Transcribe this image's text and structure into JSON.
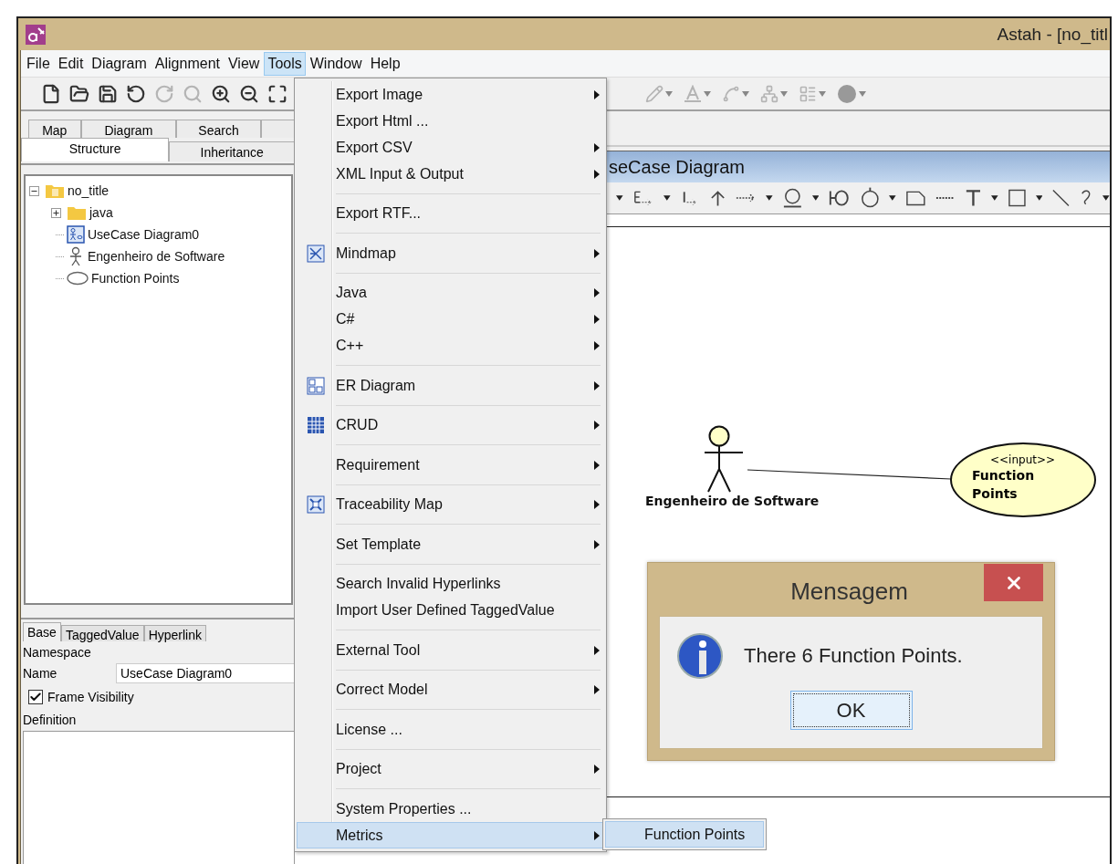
{
  "window": {
    "title": "Astah - [no_titl"
  },
  "menu_bar": [
    {
      "label": "File",
      "selected": false
    },
    {
      "label": "Edit",
      "selected": false
    },
    {
      "label": "Diagram",
      "selected": false
    },
    {
      "label": "Alignment",
      "selected": false
    },
    {
      "label": "View",
      "selected": false
    },
    {
      "label": "Tools",
      "selected": true
    },
    {
      "label": "Window",
      "selected": false
    },
    {
      "label": "Help",
      "selected": false
    }
  ],
  "toolbar": {
    "left": [
      {
        "disabled": false
      },
      {
        "disabled": false
      },
      {
        "disabled": false
      },
      {
        "disabled": false
      },
      {
        "disabled": true
      },
      {
        "disabled": true
      },
      {
        "disabled": false
      },
      {
        "disabled": false
      },
      {
        "disabled": false
      }
    ],
    "right": [
      {
        "disabled": true
      },
      {
        "disabled": true
      },
      {
        "disabled": true
      },
      {
        "disabled": true
      },
      {
        "disabled": true
      },
      {
        "disabled": true
      }
    ]
  },
  "explorer": {
    "tabs_upper": [
      {
        "label": "Map",
        "selected": false
      },
      {
        "label": "Diagram",
        "selected": false
      },
      {
        "label": "Search",
        "selected": false
      }
    ],
    "tabs_lower": [
      {
        "label": "Structure",
        "selected": true
      },
      {
        "label": "Inheritance",
        "selected": false
      }
    ],
    "tree": [
      {
        "label": "no_title",
        "kind": "project",
        "expanded": true,
        "children": [
          {
            "label": "java",
            "kind": "package",
            "expanded": false
          },
          {
            "label": "UseCase Diagram0",
            "kind": "diagram"
          },
          {
            "label": "Engenheiro de Software",
            "kind": "actor"
          },
          {
            "label": "Function Points",
            "kind": "usecase"
          }
        ]
      }
    ]
  },
  "properties": {
    "tabs": [
      {
        "label": "Base",
        "selected": true
      },
      {
        "label": "TaggedValue",
        "selected": false
      },
      {
        "label": "Hyperlink",
        "selected": false
      }
    ],
    "namespace_label": "Namespace",
    "name_label": "Name",
    "name_value": "UseCase Diagram0",
    "frame_visibility": {
      "label": "Frame Visibility",
      "checked": true
    },
    "definition_label": "Definition"
  },
  "diagram": {
    "title": "seCase Diagram",
    "actor": {
      "name": "Engenheiro de Software"
    },
    "use_case": {
      "stereotype": "<<input>>",
      "name": "Function Points"
    }
  },
  "dialog": {
    "title": "Mensagem",
    "message": "There 6 Function Points.",
    "button": "OK"
  },
  "tools_menu": [
    {
      "kind": "item",
      "label": "Export Image",
      "submenu": true,
      "icon": false,
      "selected": false
    },
    {
      "kind": "item",
      "label": "Export Html ...",
      "submenu": false,
      "icon": false,
      "selected": false
    },
    {
      "kind": "item",
      "label": "Export CSV",
      "submenu": true,
      "icon": false,
      "selected": false
    },
    {
      "kind": "item",
      "label": "XML Input & Output",
      "submenu": true,
      "icon": false,
      "selected": false
    },
    {
      "kind": "separator"
    },
    {
      "kind": "item",
      "label": "Export RTF...",
      "submenu": false,
      "icon": false,
      "selected": false
    },
    {
      "kind": "separator"
    },
    {
      "kind": "item",
      "label": "Mindmap",
      "submenu": true,
      "icon": true,
      "selected": false
    },
    {
      "kind": "separator"
    },
    {
      "kind": "item",
      "label": "Java",
      "submenu": true,
      "icon": false,
      "selected": false
    },
    {
      "kind": "item",
      "label": "C#",
      "submenu": true,
      "icon": false,
      "selected": false
    },
    {
      "kind": "item",
      "label": "C++",
      "submenu": true,
      "icon": false,
      "selected": false
    },
    {
      "kind": "separator"
    },
    {
      "kind": "item",
      "label": "ER Diagram",
      "submenu": true,
      "icon": true,
      "selected": false
    },
    {
      "kind": "separator"
    },
    {
      "kind": "item",
      "label": "CRUD",
      "submenu": true,
      "icon": true,
      "selected": false
    },
    {
      "kind": "separator"
    },
    {
      "kind": "item",
      "label": "Requirement",
      "submenu": true,
      "icon": false,
      "selected": false
    },
    {
      "kind": "separator"
    },
    {
      "kind": "item",
      "label": "Traceability Map",
      "submenu": true,
      "icon": true,
      "selected": false
    },
    {
      "kind": "separator"
    },
    {
      "kind": "item",
      "label": "Set Template",
      "submenu": true,
      "icon": false,
      "selected": false
    },
    {
      "kind": "separator"
    },
    {
      "kind": "item",
      "label": "Search Invalid Hyperlinks",
      "submenu": false,
      "icon": false,
      "selected": false
    },
    {
      "kind": "item",
      "label": "Import User Defined TaggedValue",
      "submenu": false,
      "icon": false,
      "selected": false
    },
    {
      "kind": "separator"
    },
    {
      "kind": "item",
      "label": "External Tool",
      "submenu": true,
      "icon": false,
      "selected": false
    },
    {
      "kind": "separator"
    },
    {
      "kind": "item",
      "label": "Correct Model",
      "submenu": true,
      "icon": false,
      "selected": false
    },
    {
      "kind": "separator"
    },
    {
      "kind": "item",
      "label": "License ...",
      "submenu": false,
      "icon": false,
      "selected": false
    },
    {
      "kind": "separator"
    },
    {
      "kind": "item",
      "label": "Project",
      "submenu": true,
      "icon": false,
      "selected": false
    },
    {
      "kind": "separator"
    },
    {
      "kind": "item",
      "label": "System Properties ...",
      "submenu": false,
      "icon": false,
      "selected": false
    },
    {
      "kind": "item",
      "label": "Metrics",
      "submenu": true,
      "icon": false,
      "selected": true
    }
  ],
  "metrics_submenu": [
    {
      "label": "Function Points",
      "selected": true
    }
  ]
}
